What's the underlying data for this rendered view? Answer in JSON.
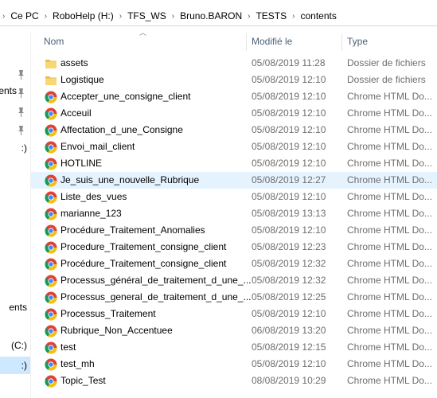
{
  "breadcrumb": [
    {
      "label": "Ce PC"
    },
    {
      "label": "RoboHelp (H:)"
    },
    {
      "label": "TFS_WS"
    },
    {
      "label": "Bruno.BARON"
    },
    {
      "label": "TESTS"
    },
    {
      "label": "contents"
    }
  ],
  "nav": {
    "items": [
      {
        "label": "",
        "pinned": true
      },
      {
        "label": "ents",
        "pinned": true
      },
      {
        "label": "",
        "pinned": true
      },
      {
        "label": "",
        "pinned": true
      },
      {
        "label": ":)",
        "pinned": false
      },
      {
        "label": "ents",
        "pinned": false
      },
      {
        "label": "(C:)",
        "pinned": false
      },
      {
        "label": ":)",
        "pinned": false,
        "selected": true
      }
    ]
  },
  "columns": {
    "name": "Nom",
    "date": "Modifié le",
    "type": "Type"
  },
  "files": [
    {
      "name": "assets",
      "date": "05/08/2019 11:28",
      "type": "Dossier de fichiers",
      "icon": "folder-icon"
    },
    {
      "name": "Logistique",
      "date": "05/08/2019 12:10",
      "type": "Dossier de fichiers",
      "icon": "folder-icon"
    },
    {
      "name": "Accepter_une_consigne_client",
      "date": "05/08/2019 12:10",
      "type": "Chrome HTML Do...",
      "icon": "chrome-icon"
    },
    {
      "name": "Acceuil",
      "date": "05/08/2019 12:10",
      "type": "Chrome HTML Do...",
      "icon": "chrome-icon"
    },
    {
      "name": "Affectation_d_une_Consigne",
      "date": "05/08/2019 12:10",
      "type": "Chrome HTML Do...",
      "icon": "chrome-icon"
    },
    {
      "name": "Envoi_mail_client",
      "date": "05/08/2019 12:10",
      "type": "Chrome HTML Do...",
      "icon": "chrome-icon"
    },
    {
      "name": "HOTLINE",
      "date": "05/08/2019 12:10",
      "type": "Chrome HTML Do...",
      "icon": "chrome-icon"
    },
    {
      "name": "Je_suis_une_nouvelle_Rubrique",
      "date": "05/08/2019 12:27",
      "type": "Chrome HTML Do...",
      "icon": "chrome-icon",
      "selected": true
    },
    {
      "name": "Liste_des_vues",
      "date": "05/08/2019 12:10",
      "type": "Chrome HTML Do...",
      "icon": "chrome-icon"
    },
    {
      "name": "marianne_123",
      "date": "05/08/2019 13:13",
      "type": "Chrome HTML Do...",
      "icon": "chrome-icon"
    },
    {
      "name": "Procédure_Traitement_Anomalies",
      "date": "05/08/2019 12:10",
      "type": "Chrome HTML Do...",
      "icon": "chrome-icon"
    },
    {
      "name": "Procedure_Traitement_consigne_client",
      "date": "05/08/2019 12:23",
      "type": "Chrome HTML Do...",
      "icon": "chrome-icon"
    },
    {
      "name": "Procédure_Traitement_consigne_client",
      "date": "05/08/2019 12:32",
      "type": "Chrome HTML Do...",
      "icon": "chrome-icon"
    },
    {
      "name": "Processus_général_de_traitement_d_une_...",
      "date": "05/08/2019 12:32",
      "type": "Chrome HTML Do...",
      "icon": "chrome-icon"
    },
    {
      "name": "Processus_general_de_traitement_d_une_...",
      "date": "05/08/2019 12:25",
      "type": "Chrome HTML Do...",
      "icon": "chrome-icon"
    },
    {
      "name": "Processus_Traitement",
      "date": "05/08/2019 12:10",
      "type": "Chrome HTML Do...",
      "icon": "chrome-icon"
    },
    {
      "name": "Rubrique_Non_Accentuee",
      "date": "06/08/2019 13:20",
      "type": "Chrome HTML Do...",
      "icon": "chrome-icon"
    },
    {
      "name": "test",
      "date": "05/08/2019 12:15",
      "type": "Chrome HTML Do...",
      "icon": "chrome-icon"
    },
    {
      "name": "test_mh",
      "date": "05/08/2019 12:10",
      "type": "Chrome HTML Do...",
      "icon": "chrome-icon"
    },
    {
      "name": "Topic_Test",
      "date": "08/08/2019 10:29",
      "type": "Chrome HTML Do...",
      "icon": "chrome-icon"
    }
  ],
  "colors": {
    "selected_row": "#e5f3ff",
    "header_text": "#4c607a",
    "folder": "#f8d775"
  }
}
